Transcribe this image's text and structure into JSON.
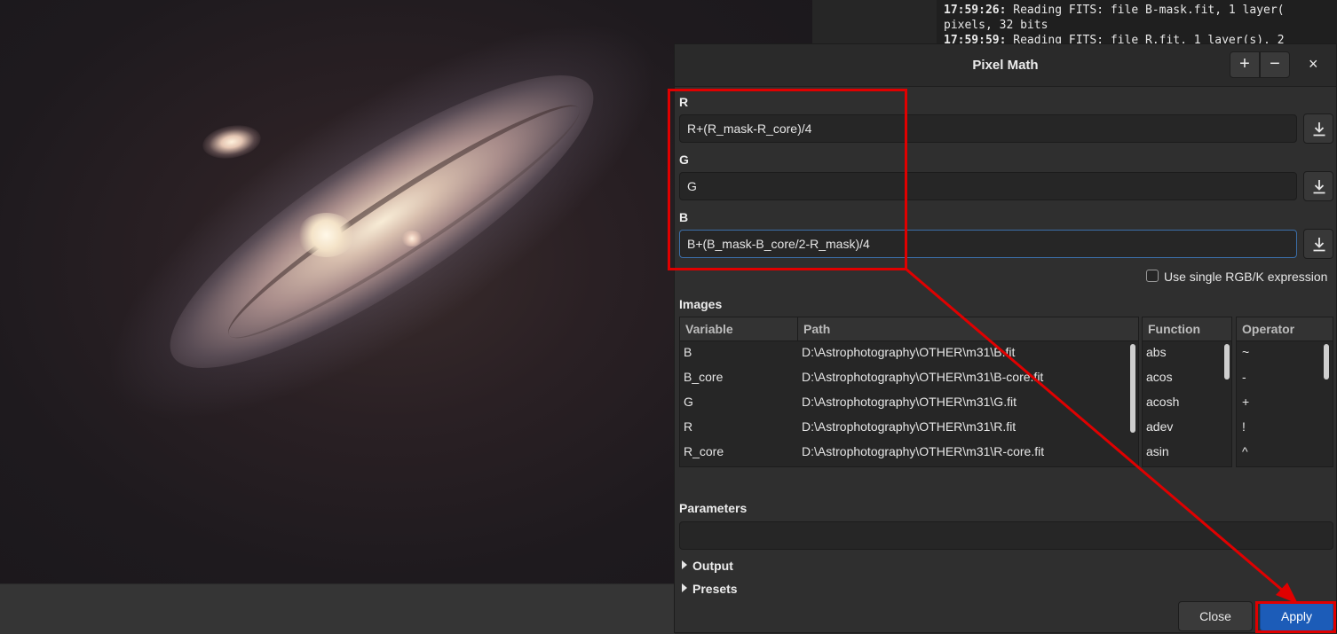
{
  "log": {
    "lines": [
      {
        "time": "17:59:26:",
        "text": " Reading FITS: file B-mask.fit, 1 layer("
      },
      {
        "time": "",
        "text": "pixels, 32 bits"
      },
      {
        "time": "17:59:59:",
        "text": " Reading FITS: file R.fit, 1 layer(s), 2"
      }
    ]
  },
  "dialog": {
    "title": "Pixel Math",
    "add_label": "+",
    "remove_label": "−",
    "close_label": "×",
    "expressions": [
      {
        "label": "R",
        "value": "R+(R_mask-R_core)/4"
      },
      {
        "label": "G",
        "value": "G"
      },
      {
        "label": "B",
        "value": "B+(B_mask-B_core/2-R_mask)/4"
      }
    ],
    "single_expression_label": "Use single RGB/K expression",
    "single_expression_checked": false,
    "images_label": "Images",
    "images_columns": [
      "Variable",
      "Path"
    ],
    "images": [
      {
        "variable": "B",
        "path": "D:\\Astrophotography\\OTHER\\m31\\B.fit"
      },
      {
        "variable": "B_core",
        "path": "D:\\Astrophotography\\OTHER\\m31\\B-core.fit"
      },
      {
        "variable": "G",
        "path": "D:\\Astrophotography\\OTHER\\m31\\G.fit"
      },
      {
        "variable": "R",
        "path": "D:\\Astrophotography\\OTHER\\m31\\R.fit"
      },
      {
        "variable": "R_core",
        "path": "D:\\Astrophotography\\OTHER\\m31\\R-core.fit"
      }
    ],
    "function_column": "Function",
    "functions": [
      "abs",
      "acos",
      "acosh",
      "adev",
      "asin"
    ],
    "operator_column": "Operator",
    "operators": [
      "~",
      "-",
      "+",
      "!",
      "^"
    ],
    "parameters_label": "Parameters",
    "parameters_value": "",
    "output_label": "Output",
    "presets_label": "Presets",
    "close_button": "Close",
    "apply_button": "Apply"
  },
  "colors": {
    "annotation": "#e00000",
    "accent": "#1c5cb8",
    "background": "#2f2f2f"
  }
}
